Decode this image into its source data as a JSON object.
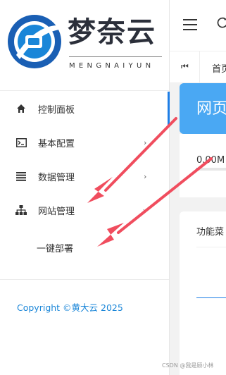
{
  "brand": {
    "name": "梦奈云",
    "subtitle": "MENGNAIYUN",
    "colors": {
      "primary": "#1e7ee6",
      "logo_blue": "#1a86d8"
    }
  },
  "sidebar": {
    "items": [
      {
        "label": "控制面板",
        "icon": "home-icon",
        "active": true
      },
      {
        "label": "基本配置",
        "icon": "terminal-icon",
        "has_children": true
      },
      {
        "label": "数据管理",
        "icon": "list-icon",
        "has_children": true
      },
      {
        "label": "网站管理",
        "icon": "sitemap-icon",
        "has_children": true
      },
      {
        "label": "一键部署",
        "icon": "",
        "submenu": true
      }
    ],
    "chevron": "›",
    "copyright": "Copyright ©黄大云 2025"
  },
  "topbar": {
    "menu_icon": "hamburger-icon",
    "refresh_icon": "refresh-icon"
  },
  "tabs": {
    "prev_label": "⏮",
    "home_label": "首页"
  },
  "main": {
    "banner_title": "网页",
    "stat_value": "0.00M",
    "stat_progress": 0.02,
    "func_title": "功能菜"
  },
  "watermark": "CSDN @我是顾小林",
  "annotation": {
    "arrow_color": "#f04d5e"
  }
}
